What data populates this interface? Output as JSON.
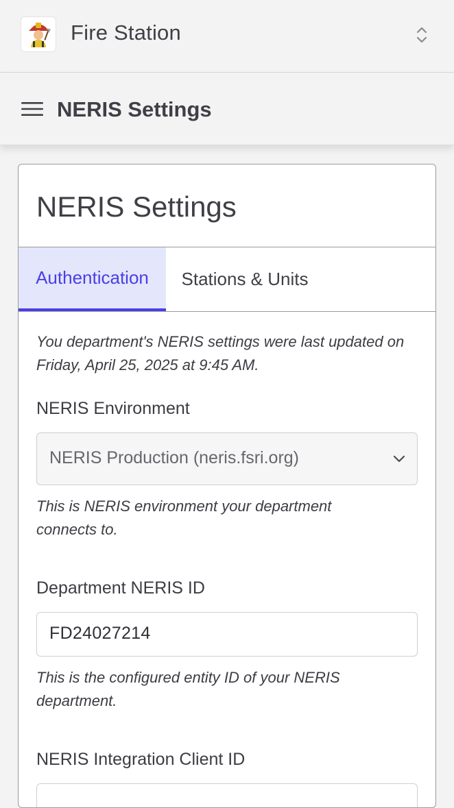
{
  "org": {
    "name": "Fire Station",
    "logo_icon": "firefighter-logo-icon",
    "switch_icon": "chevron-up-down-icon"
  },
  "page": {
    "title": "NERIS Settings",
    "menu_icon": "hamburger-menu-icon"
  },
  "card": {
    "title": "NERIS Settings",
    "tabs": [
      {
        "label": "Authentication",
        "active": true
      },
      {
        "label": "Stations & Units",
        "active": false
      }
    ],
    "last_updated_note": "You department's NERIS settings were last updated on Friday, April 25, 2025 at 9:45 AM.",
    "environment": {
      "label": "NERIS Environment",
      "value": "NERIS Production (neris.fsri.org)",
      "help": "This is NERIS environment your department connects to."
    },
    "department_id": {
      "label": "Department NERIS ID",
      "value": "FD24027214",
      "help": "This is the configured entity ID of your NERIS department."
    },
    "client_id": {
      "label": "NERIS Integration Client ID",
      "value": ""
    }
  },
  "colors": {
    "accent": "#4a3ee6",
    "active_tab_bg": "#e4e6fb",
    "page_bg": "#f3f3f3",
    "border": "#9a9aa0"
  }
}
